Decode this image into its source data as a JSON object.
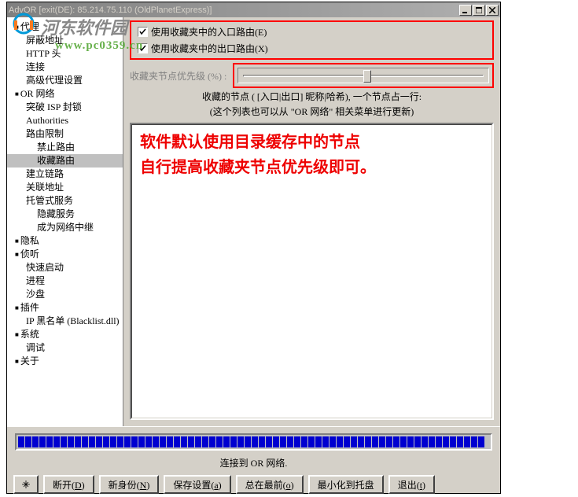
{
  "title": "AdvOR [exit(DE): 85.214.75.110 (OldPlanetExpress)]",
  "sidebar": {
    "items": [
      {
        "label": "代理",
        "bullet": true
      },
      {
        "label": "屏蔽地址",
        "child": 1
      },
      {
        "label": "HTTP 头",
        "child": 1
      },
      {
        "label": "连接",
        "child": 1
      },
      {
        "label": "高级代理设置",
        "child": 1
      },
      {
        "label": "OR 网络",
        "bullet": true
      },
      {
        "label": "突破 ISP 封锁",
        "child": 1
      },
      {
        "label": "Authorities",
        "child": 1
      },
      {
        "label": "路由限制",
        "child": 1
      },
      {
        "label": "禁止路由",
        "child": 2
      },
      {
        "label": "收藏路由",
        "child": 2,
        "selected": true
      },
      {
        "label": "建立链路",
        "child": 1
      },
      {
        "label": "关联地址",
        "child": 1
      },
      {
        "label": "托管式服务",
        "child": 1
      },
      {
        "label": "隐藏服务",
        "child": 2
      },
      {
        "label": "成为网络中继",
        "child": 2
      },
      {
        "label": "隐私",
        "bullet": true
      },
      {
        "label": "侦听",
        "bullet": true
      },
      {
        "label": "快速启动",
        "child": 1
      },
      {
        "label": "进程",
        "child": 1
      },
      {
        "label": "沙盘",
        "child": 1
      },
      {
        "label": "插件",
        "bullet": true
      },
      {
        "label": "IP 黑名单 (Blacklist.dll)",
        "child": 1
      },
      {
        "label": "系统",
        "bullet": true
      },
      {
        "label": "调试",
        "child": 1
      },
      {
        "label": "关于",
        "bullet": true
      }
    ]
  },
  "checkboxes": {
    "entry": "使用收藏夹中的入口路由(E)",
    "exit": "使用收藏夹中的出口路由(X)"
  },
  "slider": {
    "label": "收藏夹节点优先级 (%) :"
  },
  "info": {
    "line1": "收藏的节点 ( [入口|出口] 昵称|哈希), 一个节点占一行:",
    "line2": "(这个列表也可以从 \"OR 网络\" 相关菜单进行更新)"
  },
  "overlay": {
    "line1": "软件默认使用目录缓存中的节点",
    "line2": "自行提高收藏夹节点优先级即可。"
  },
  "status": "连接到 OR 网络.",
  "buttons": {
    "disconnect": "断开(D)",
    "identity": "新身份(N)",
    "save": "保存设置(a)",
    "top": "总在最前(o)",
    "tray": "最小化到托盘",
    "quit": "退出(t)"
  },
  "watermark": {
    "brand": "河东软件园",
    "url": "www.pc0359.cn"
  }
}
